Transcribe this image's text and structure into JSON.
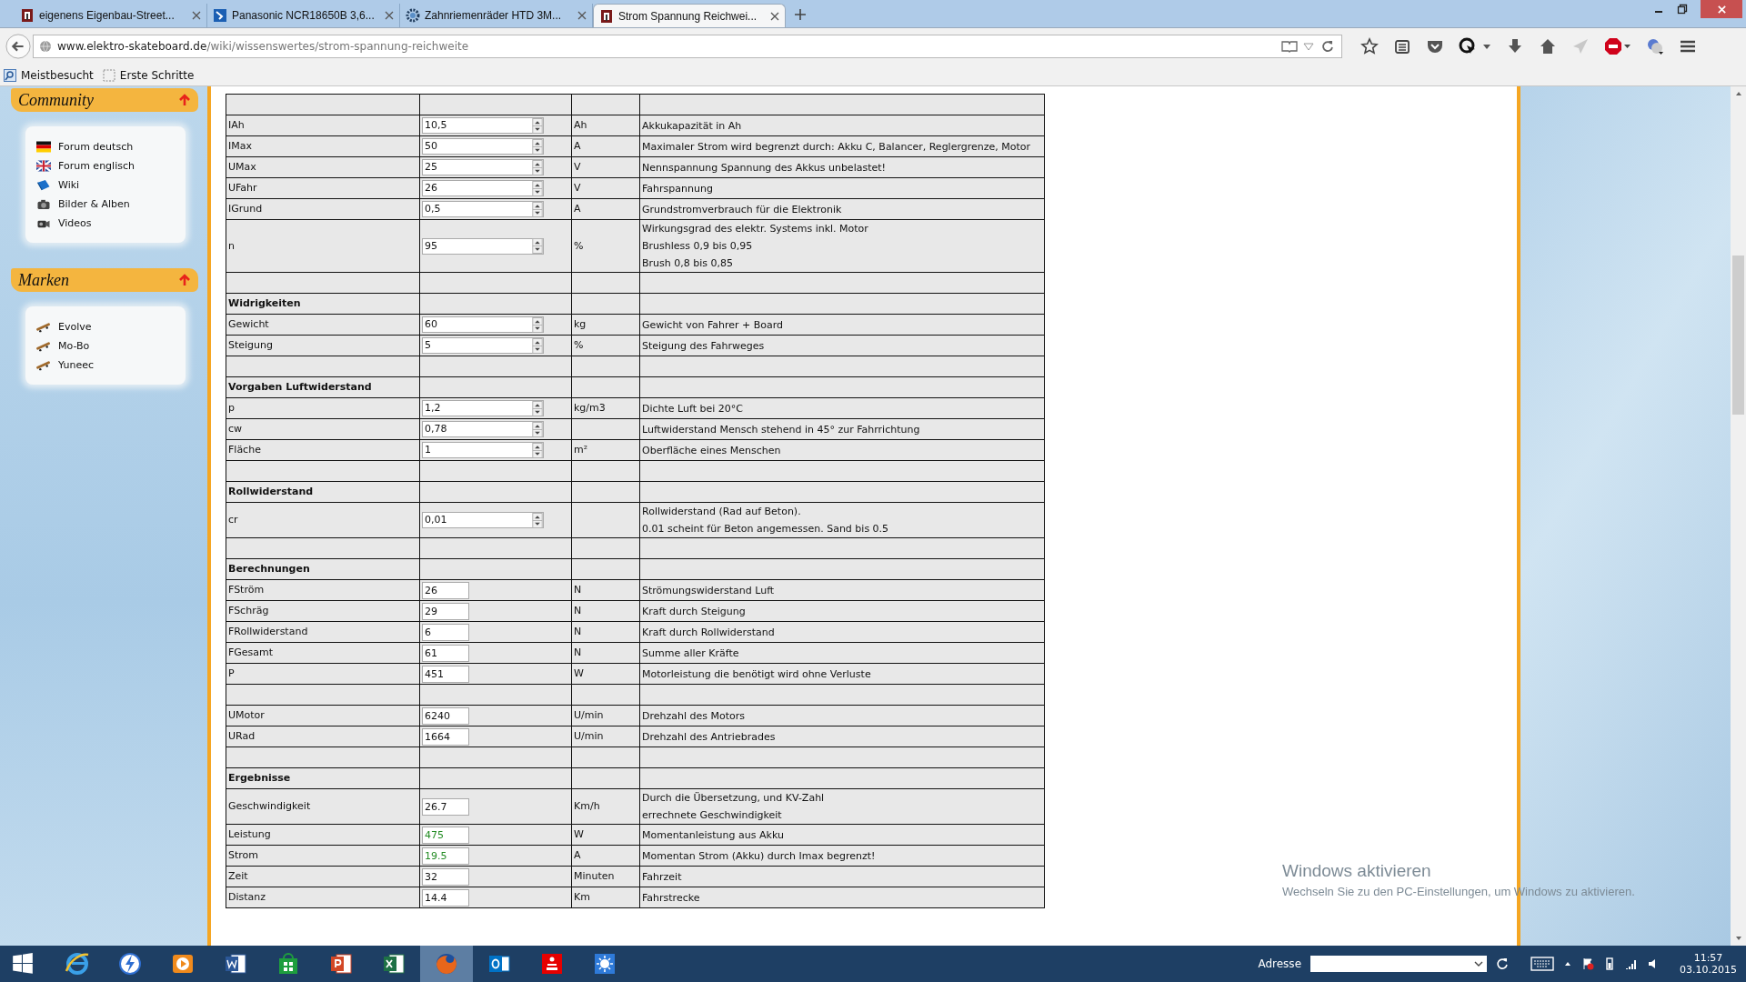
{
  "browser": {
    "tabs": [
      {
        "title": "eigenens Eigenbau-Street...",
        "kind": "site",
        "selected": false
      },
      {
        "title": "Panasonic NCR18650B 3,6...",
        "kind": "shop",
        "selected": false
      },
      {
        "title": "Zahnriemenräder HTD 3M...",
        "kind": "gear",
        "selected": false
      },
      {
        "title": "Strom Spannung Reichwei...",
        "kind": "site",
        "selected": true
      }
    ],
    "url": {
      "host": "www.elektro-skateboard.de",
      "path": "/wiki/wissenswertes/strom-spannung-reichweite"
    },
    "bookmarks": [
      {
        "label": "Meistbesucht",
        "kind": "search"
      },
      {
        "label": "Erste Schritte",
        "kind": "page"
      }
    ]
  },
  "sidebar": {
    "sections": [
      {
        "title": "Community",
        "items": [
          {
            "label": "Forum deutsch",
            "kind": "flag-de"
          },
          {
            "label": "Forum englisch",
            "kind": "flag-uk"
          },
          {
            "label": "Wiki",
            "kind": "book"
          },
          {
            "label": "Bilder & Alben",
            "kind": "camera"
          },
          {
            "label": "Videos",
            "kind": "video"
          }
        ]
      },
      {
        "title": "Marken",
        "items": [
          {
            "label": "Evolve",
            "kind": "board"
          },
          {
            "label": "Mo-Bo",
            "kind": "board"
          },
          {
            "label": "Yuneec",
            "kind": "board"
          }
        ]
      }
    ]
  },
  "table": {
    "rows": [
      {
        "kind": "spacer"
      },
      {
        "kind": "input",
        "label": "IAh",
        "value": "10,5",
        "unit": "Ah",
        "description": [
          "Akkukapazität in Ah"
        ]
      },
      {
        "kind": "input",
        "label": "IMax",
        "value": "50",
        "unit": "A",
        "description": [
          "Maximaler Strom wird begrenzt durch: Akku C, Balancer, Reglergrenze, Motor"
        ]
      },
      {
        "kind": "input",
        "label": "UMax",
        "value": "25",
        "unit": "V",
        "description": [
          "Nennspannung Spannung des Akkus unbelastet!"
        ]
      },
      {
        "kind": "input",
        "label": "UFahr",
        "value": "26",
        "unit": "V",
        "description": [
          "Fahrspannung"
        ]
      },
      {
        "kind": "input",
        "label": "IGrund",
        "value": "0,5",
        "unit": "A",
        "description": [
          "Grundstromverbrauch für die Elektronik"
        ]
      },
      {
        "kind": "input",
        "label": "n",
        "value": "95",
        "unit": "%",
        "description": [
          "Wirkungsgrad des elektr. Systems inkl. Motor",
          "Brushless 0,9 bis 0,95",
          "Brush 0,8 bis 0,85"
        ]
      },
      {
        "kind": "spacer"
      },
      {
        "kind": "section",
        "label": "Widrigkeiten"
      },
      {
        "kind": "input",
        "label": "Gewicht",
        "value": "60",
        "unit": "kg",
        "description": [
          "Gewicht von Fahrer + Board"
        ]
      },
      {
        "kind": "input",
        "label": "Steigung",
        "value": "5",
        "unit": "%",
        "description": [
          "Steigung des Fahrweges"
        ]
      },
      {
        "kind": "spacer"
      },
      {
        "kind": "section",
        "label": "Vorgaben Luftwiderstand"
      },
      {
        "kind": "input",
        "label": "p",
        "value": "1,2",
        "unit": "kg/m3",
        "description": [
          "Dichte Luft bei 20°C"
        ]
      },
      {
        "kind": "input",
        "label": "cw",
        "value": "0,78",
        "description": [
          "Luftwiderstand Mensch stehend in 45° zur Fahrrichtung"
        ]
      },
      {
        "kind": "input",
        "label": "Fläche",
        "value": "1",
        "unit": "m²",
        "description": [
          "Oberfläche eines Menschen"
        ]
      },
      {
        "kind": "spacer"
      },
      {
        "kind": "section",
        "label": "Rollwiderstand"
      },
      {
        "kind": "input",
        "label": "cr",
        "value": "0,01",
        "description": [
          "Rollwiderstand (Rad auf Beton).",
          "0.01 scheint für Beton angemessen. Sand bis 0.5"
        ]
      },
      {
        "kind": "spacer"
      },
      {
        "kind": "section",
        "label": "Berechnungen"
      },
      {
        "kind": "output",
        "label": "FStröm",
        "value": "26",
        "unit": "N",
        "description": [
          "Strömungswiderstand Luft"
        ]
      },
      {
        "kind": "output",
        "label": "FSchräg",
        "value": "29",
        "unit": "N",
        "description": [
          "Kraft durch Steigung"
        ]
      },
      {
        "kind": "output",
        "label": "FRollwiderstand",
        "value": "6",
        "unit": "N",
        "description": [
          "Kraft durch Rollwiderstand"
        ]
      },
      {
        "kind": "output",
        "label": "FGesamt",
        "value": "61",
        "unit": "N",
        "description": [
          "Summe aller Kräfte"
        ]
      },
      {
        "kind": "output",
        "label": "P",
        "value": "451",
        "unit": "W",
        "description": [
          "Motorleistung die benötigt wird ohne Verluste"
        ]
      },
      {
        "kind": "spacer"
      },
      {
        "kind": "output",
        "label": "UMotor",
        "value": "6240",
        "unit": "U/min",
        "description": [
          "Drehzahl des Motors"
        ]
      },
      {
        "kind": "output",
        "label": "URad",
        "value": "1664",
        "unit": "U/min",
        "description": [
          "Drehzahl des Antriebrades"
        ]
      },
      {
        "kind": "spacer"
      },
      {
        "kind": "section",
        "label": "Ergebnisse"
      },
      {
        "kind": "output",
        "label": "Geschwindigkeit",
        "value": "26.7",
        "unit": "Km/h",
        "description": [
          "Durch die Übersetzung, und KV-Zahl",
          "errechnete Geschwindigkeit"
        ]
      },
      {
        "kind": "output",
        "label": "Leistung",
        "value": "475",
        "unit": "W",
        "color": "#228b22",
        "description": [
          "Momentanleistung aus Akku"
        ]
      },
      {
        "kind": "output",
        "label": "Strom",
        "value": "19.5",
        "unit": "A",
        "color": "#228b22",
        "description": [
          "Momentan Strom (Akku) durch Imax begrenzt!"
        ]
      },
      {
        "kind": "output",
        "label": "Zeit",
        "value": "32",
        "unit": "Minuten",
        "description": [
          "Fahrzeit"
        ]
      },
      {
        "kind": "output",
        "label": "Distanz",
        "value": "14.4",
        "unit": "Km",
        "description": [
          "Fahrstrecke"
        ]
      }
    ]
  },
  "activation": {
    "title": "Windows aktivieren",
    "text": "Wechseln Sie zu den PC-Einstellungen, um Windows zu aktivieren."
  },
  "taskbar": {
    "apps": [
      {
        "kind": "ie",
        "selected": false
      },
      {
        "kind": "bolt",
        "selected": false
      },
      {
        "kind": "media",
        "selected": false
      },
      {
        "kind": "word",
        "selected": false
      },
      {
        "kind": "store",
        "selected": false
      },
      {
        "kind": "powerpoint",
        "selected": false
      },
      {
        "kind": "excel",
        "selected": false
      },
      {
        "kind": "firefox",
        "selected": true
      },
      {
        "kind": "outlook",
        "selected": false
      },
      {
        "kind": "bank",
        "selected": false
      },
      {
        "kind": "sun",
        "selected": false
      }
    ],
    "address_label": "Adresse",
    "time": "11:57",
    "date": "03.10.2015"
  }
}
